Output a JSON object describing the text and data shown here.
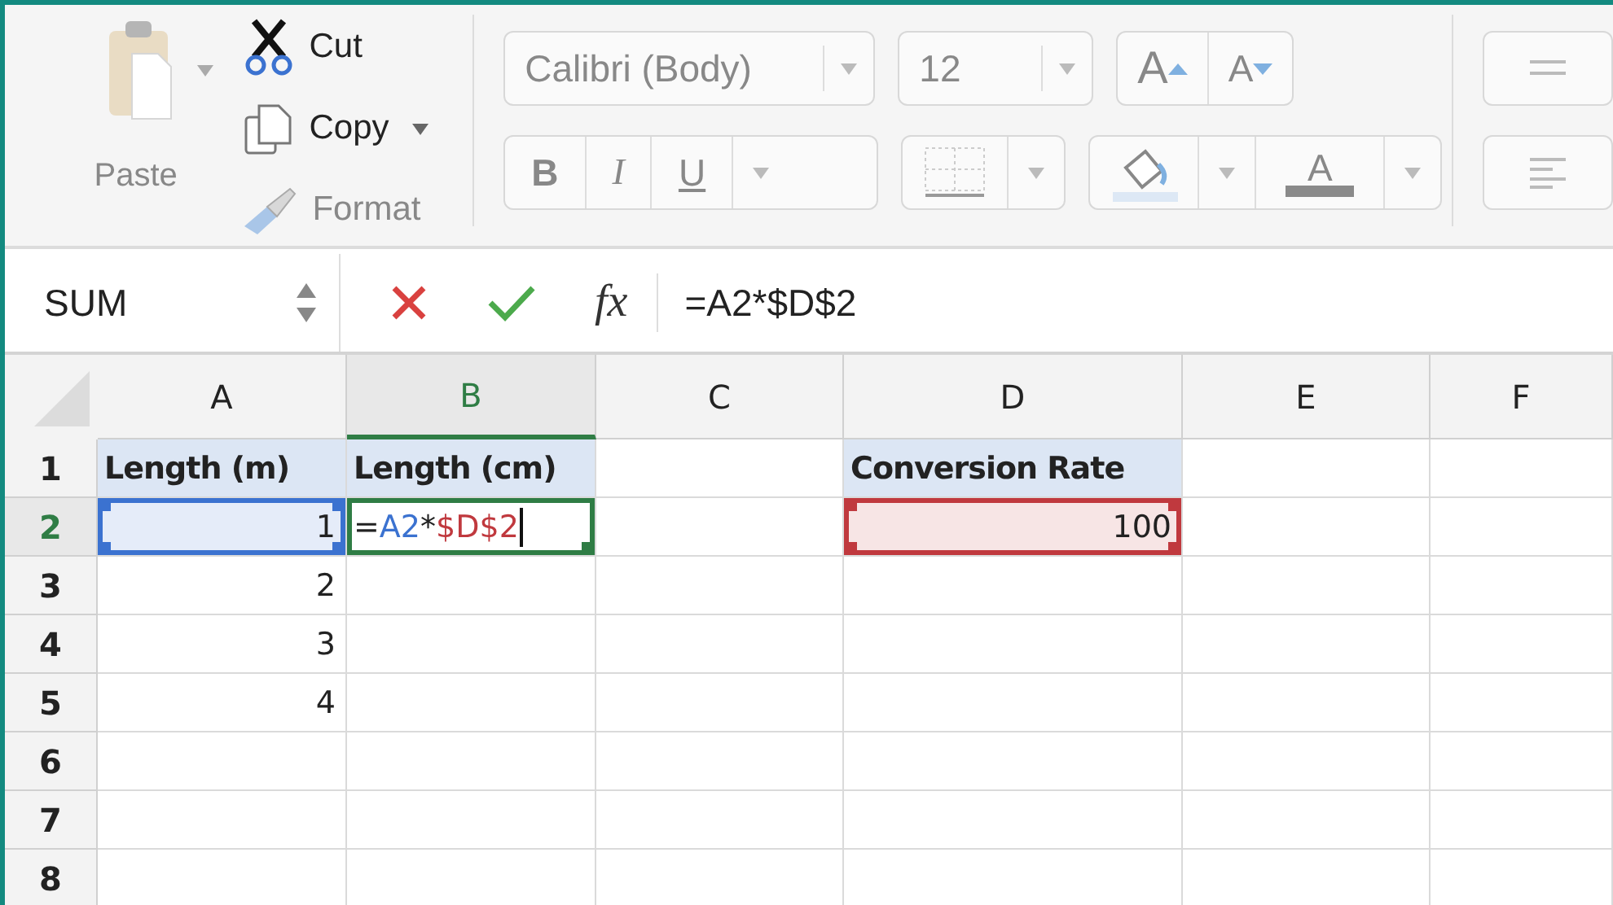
{
  "ribbon": {
    "clipboard": {
      "paste": "Paste",
      "cut": "Cut",
      "copy": "Copy",
      "format": "Format"
    },
    "font": {
      "font_name": "Calibri (Body)",
      "font_size": "12",
      "grow": "A",
      "shrink": "A",
      "bold": "B",
      "italic": "I",
      "underline": "U",
      "font_color": "A"
    }
  },
  "formula_bar": {
    "name_box": "SUM",
    "fx": "fx",
    "formula": "=A2*$D$2"
  },
  "sheet": {
    "columns": [
      {
        "label": "A",
        "selected": false
      },
      {
        "label": "B",
        "selected": true
      },
      {
        "label": "C",
        "selected": false
      },
      {
        "label": "D",
        "selected": false
      },
      {
        "label": "E",
        "selected": false
      },
      {
        "label": "F",
        "selected": false
      }
    ],
    "rows": [
      {
        "label": "1",
        "selected": false,
        "cells": [
          {
            "kind": "header",
            "text": "Length (m)"
          },
          {
            "kind": "header",
            "text": "Length (cm)"
          },
          null,
          {
            "kind": "header",
            "text": "Conversion Rate"
          },
          null,
          null
        ]
      },
      {
        "label": "2",
        "selected": true,
        "cells": [
          {
            "kind": "number",
            "text": "1",
            "color": "#3b72d0"
          },
          {
            "kind": "editor",
            "color": "#2f7d45",
            "tokens": [
              {
                "text": "=",
                "color": "#222222"
              },
              {
                "text": "A2",
                "color": "#3b72d0"
              },
              {
                "text": "*",
                "color": "#222222"
              },
              {
                "text": "$D$2",
                "color": "#c0393e"
              }
            ]
          },
          null,
          {
            "kind": "number",
            "text": "100",
            "color": "#c0393e"
          },
          null,
          null
        ]
      },
      {
        "label": "3",
        "selected": false,
        "cells": [
          {
            "kind": "number",
            "text": "2"
          },
          null,
          null,
          null,
          null,
          null
        ]
      },
      {
        "label": "4",
        "selected": false,
        "cells": [
          {
            "kind": "number",
            "text": "3"
          },
          null,
          null,
          null,
          null,
          null
        ]
      },
      {
        "label": "5",
        "selected": false,
        "cells": [
          {
            "kind": "number",
            "text": "4"
          },
          null,
          null,
          null,
          null,
          null
        ]
      },
      {
        "label": "6",
        "selected": false
      },
      {
        "label": "7",
        "selected": false
      },
      {
        "label": "8",
        "selected": false
      }
    ]
  }
}
